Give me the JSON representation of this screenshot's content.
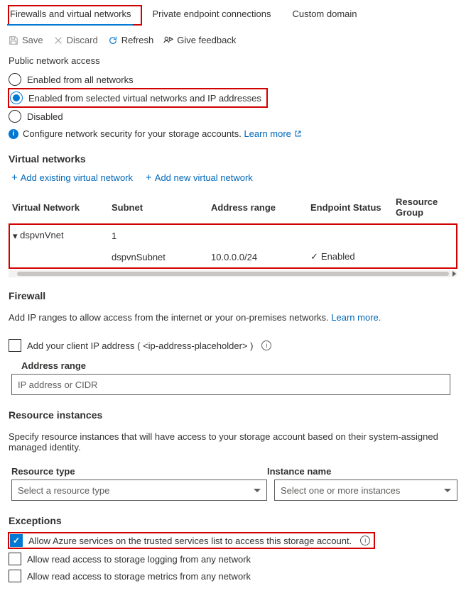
{
  "tabs": {
    "firewalls": "Firewalls and virtual networks",
    "private": "Private endpoint connections",
    "custom": "Custom domain"
  },
  "toolbar": {
    "save": "Save",
    "discard": "Discard",
    "refresh": "Refresh",
    "feedback": "Give feedback"
  },
  "public_access": {
    "title": "Public network access",
    "all": "Enabled from all networks",
    "selected": "Enabled from selected virtual networks and IP addresses",
    "disabled": "Disabled",
    "info_text": "Configure network security for your storage accounts. ",
    "learn_more": "Learn more"
  },
  "vnet": {
    "title": "Virtual networks",
    "add_existing": "Add existing virtual network",
    "add_new": "Add new virtual network",
    "headers": {
      "vn": "Virtual Network",
      "subnet": "Subnet",
      "addr": "Address range",
      "status": "Endpoint Status",
      "rg": "Resource Group"
    },
    "row1": {
      "name": "dspvnVnet",
      "subnet_count": "1"
    },
    "row2": {
      "subnet": "dspvnSubnet",
      "addr": "10.0.0.0/24",
      "status": "Enabled"
    }
  },
  "firewall": {
    "title": "Firewall",
    "desc_pre": "Add IP ranges to allow access from the internet or your on-premises networks. ",
    "learn_more": "Learn more.",
    "client_ip_pre": "Add your client IP address ( ",
    "client_ip_val": "<ip-address-placeholder>",
    "client_ip_post": " )",
    "addr_label": "Address range",
    "addr_placeholder": "IP address or CIDR"
  },
  "resinst": {
    "title": "Resource instances",
    "desc": "Specify resource instances that will have access to your storage account based on their system-assigned managed identity.",
    "col_type": "Resource type",
    "col_name": "Instance name",
    "type_placeholder": "Select a resource type",
    "name_placeholder": "Select one or more instances"
  },
  "exceptions": {
    "title": "Exceptions",
    "trusted": "Allow Azure services on the trusted services list to access this storage account.",
    "logging": "Allow read access to storage logging from any network",
    "metrics": "Allow read access to storage metrics from any network"
  }
}
